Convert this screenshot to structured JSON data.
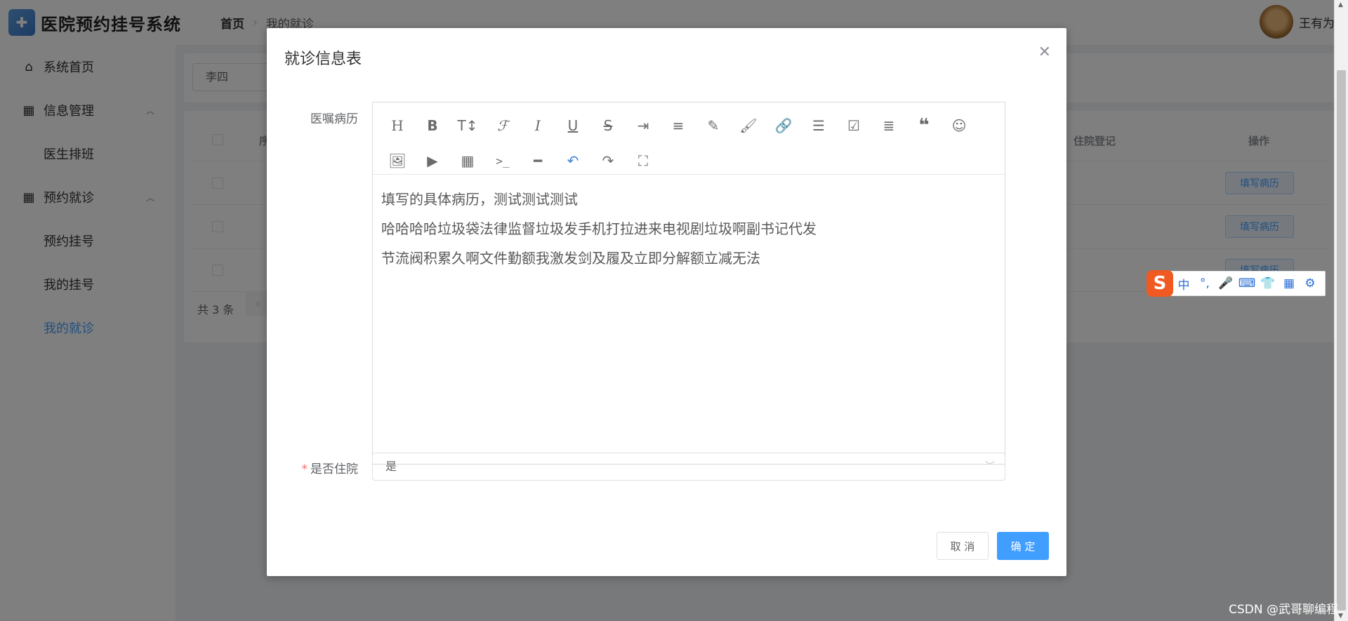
{
  "app": {
    "title": "医院预约挂号系统",
    "logo_icon": "hospital-logo-icon"
  },
  "breadcrumb": {
    "home": "首页",
    "current": "我的就诊"
  },
  "user": {
    "name": "王有为"
  },
  "sidebar": {
    "items": [
      {
        "label": "系统首页",
        "icon": "home-icon"
      },
      {
        "label": "信息管理",
        "icon": "grid-icon"
      },
      {
        "label": "医生排班"
      },
      {
        "label": "预约就诊",
        "icon": "grid-icon"
      },
      {
        "label": "预约挂号"
      },
      {
        "label": "我的挂号"
      },
      {
        "label": "我的就诊"
      }
    ]
  },
  "filter": {
    "value": "李四"
  },
  "table": {
    "headers": {
      "index": "序号",
      "register": "住院登记",
      "action": "操作"
    },
    "row_action": "填写病历",
    "total": "共 3 条"
  },
  "dialog": {
    "title": "就诊信息表",
    "record_label": "医嘱病历",
    "record_lines": [
      "填写的具体病历，测试测试测试",
      "哈哈哈哈垃圾袋法律监督垃圾发手机打拉进来电视剧垃圾啊副书记代发",
      "节流阀积累久啊文件勤额我激发剑及履及立即分解额立减无法"
    ],
    "hosp_label": "是否住院",
    "hosp_value": "是",
    "cancel": "取 消",
    "ok": "确 定"
  },
  "ime": {
    "logo": "S",
    "lang": "中"
  },
  "watermark": "CSDN @武哥聊编程",
  "colors": {
    "primary": "#409eff",
    "ime": "#f05a22",
    "required": "#f56c6c"
  }
}
